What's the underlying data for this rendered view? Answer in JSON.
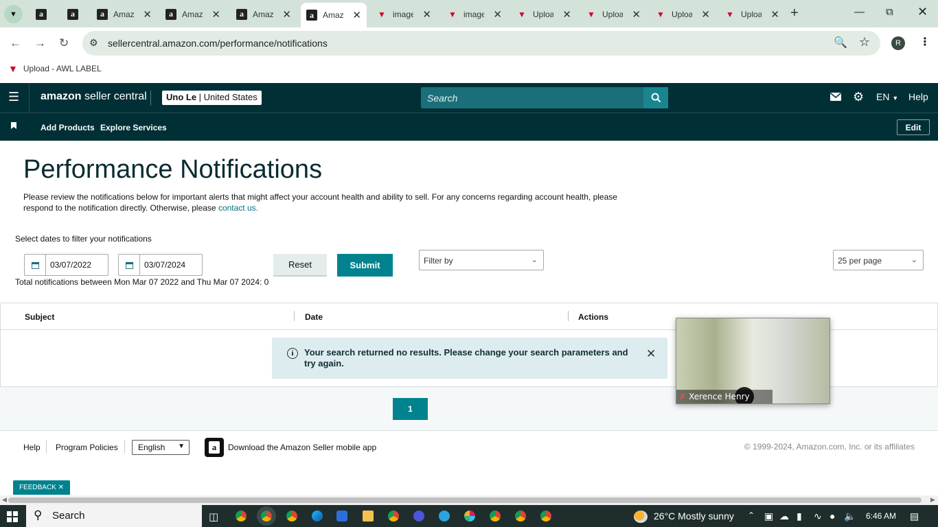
{
  "browser": {
    "tabs": [
      {
        "label": "",
        "favicon": "amazon"
      },
      {
        "label": "",
        "favicon": "amazon"
      },
      {
        "label": "Amaz",
        "favicon": "amazon"
      },
      {
        "label": "Amaz",
        "favicon": "amazon"
      },
      {
        "label": "Amaz",
        "favicon": "amazon"
      },
      {
        "label": "Amaz",
        "favicon": "amazon",
        "active": true
      },
      {
        "label": "image",
        "favicon": "awl-triangle"
      },
      {
        "label": "image",
        "favicon": "awl-triangle"
      },
      {
        "label": "Uploa",
        "favicon": "awl-triangle"
      },
      {
        "label": "Uploa",
        "favicon": "awl-triangle"
      },
      {
        "label": "Uploa",
        "favicon": "awl-triangle"
      },
      {
        "label": "Uploa",
        "favicon": "awl-triangle"
      }
    ],
    "url": "sellercentral.amazon.com/performance/notifications",
    "profile_initial": "R",
    "bookmark": "Upload - AWL LABEL"
  },
  "header": {
    "logo_bold": "amazon",
    "logo_rest": " seller central",
    "account_name": "Uno Le",
    "account_region": "United States",
    "search_placeholder": "Search",
    "language": "EN",
    "help": "Help"
  },
  "subnav": {
    "links": [
      "Add Products",
      "Explore Services"
    ],
    "edit": "Edit"
  },
  "content": {
    "title": "Performance Notifications",
    "description": "Please review the notifications below for important alerts that might affect your account health and ability to sell. For any concerns regarding account health, please respond to the notification directly. Otherwise, please ",
    "contact_link": "contact us.",
    "filter_hint": "Select dates to filter your notifications",
    "start_date": "03/07/2022",
    "end_date": "03/07/2024",
    "reset": "Reset",
    "submit": "Submit",
    "filter_by": "Filter by",
    "per_page": "25 per page",
    "total_line": "Total notifications between Mon Mar 07 2022 and Thu Mar 07 2024: 0"
  },
  "table": {
    "columns": [
      "Subject",
      "Date",
      "Actions"
    ],
    "empty_message": "Your search returned no results. Please change your search parameters and try again."
  },
  "pagination": {
    "current_page": "1"
  },
  "footer": {
    "help": "Help",
    "program_policies": "Program Policies",
    "language": "English",
    "app_download": "Download the Amazon Seller mobile app",
    "copyright": "© 1999-2024, Amazon.com, Inc. or its affiliates",
    "feedback": "FEEDBACK"
  },
  "video_overlay": {
    "participant": "Xerence Henry"
  },
  "taskbar": {
    "search": "Search",
    "weather": "26°C  Mostly sunny",
    "time": "6:46 AM"
  },
  "colors": {
    "header_bg": "#002f36",
    "accent_teal": "#00838f",
    "link": "#007185",
    "alert_bg": "#ddecee"
  }
}
